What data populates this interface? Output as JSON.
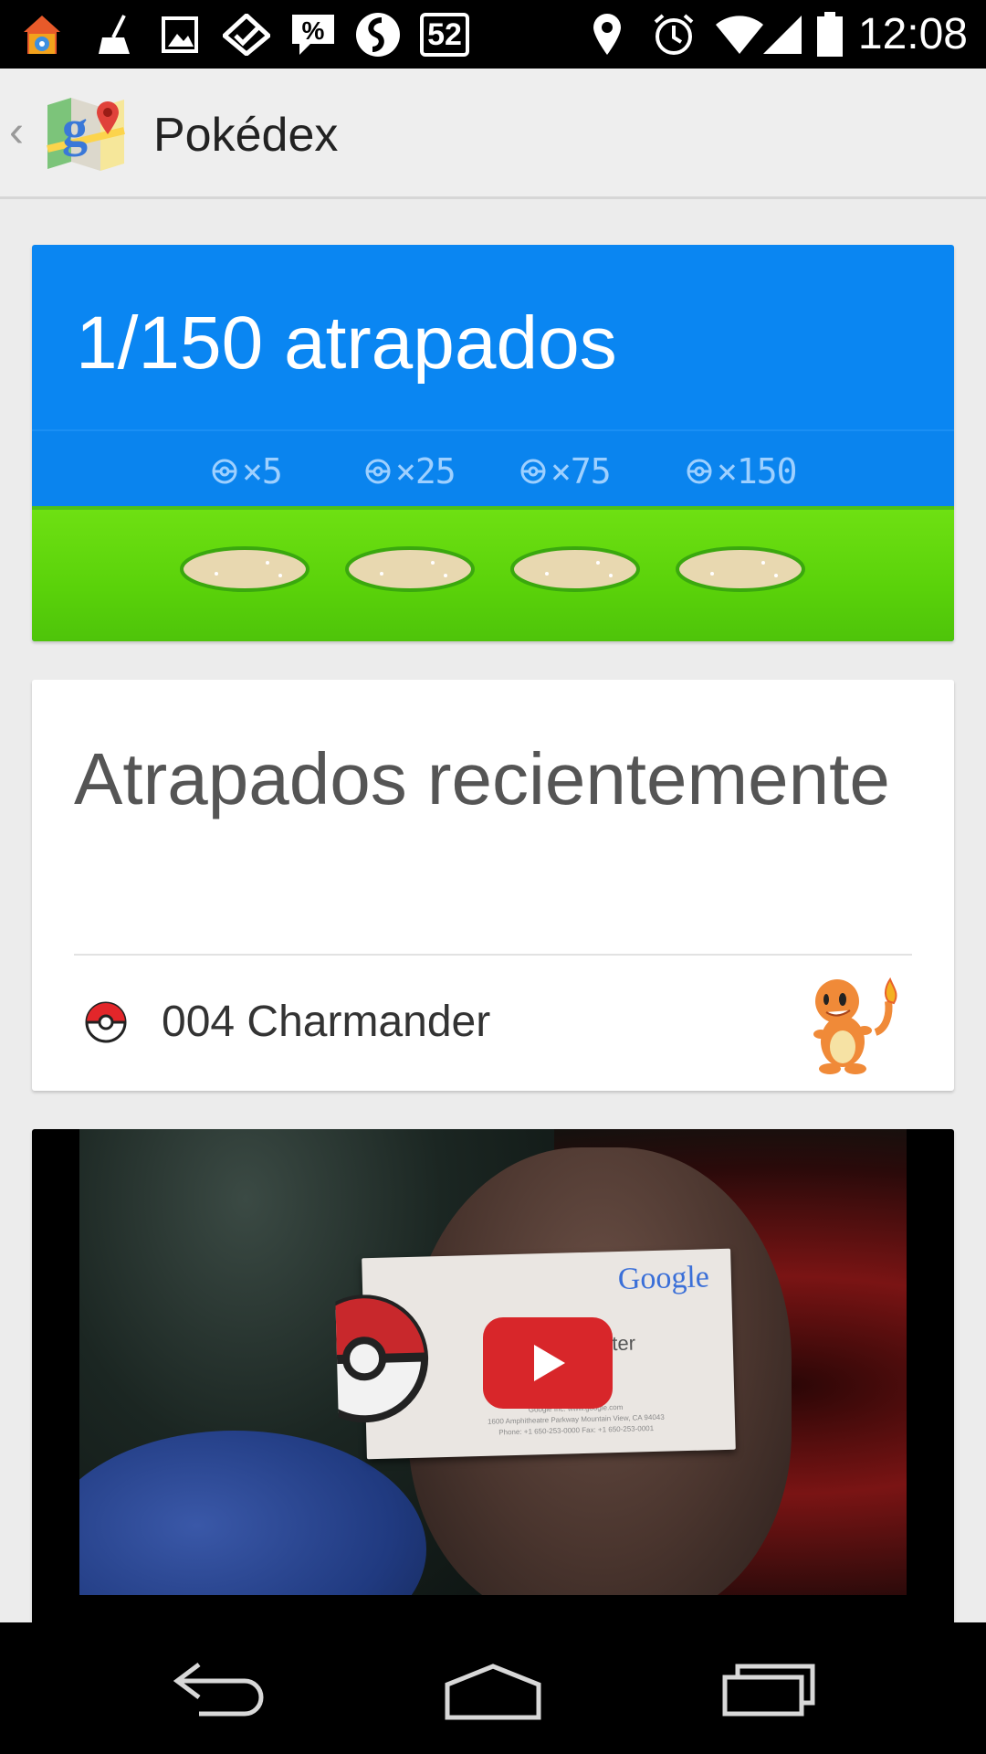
{
  "status_bar": {
    "time": "12:08",
    "notification_badge": "52",
    "icons": [
      "home-color-icon",
      "broom-icon",
      "image-icon",
      "double-check-icon",
      "percent-bubble-icon",
      "shazam-icon",
      "badge-52-icon",
      "location-icon",
      "alarm-icon",
      "wifi-icon",
      "signal-icon",
      "battery-icon"
    ]
  },
  "action_bar": {
    "title": "Pokédex",
    "up_icon": "back-caret-icon",
    "app_icon": "google-maps-icon"
  },
  "progress_card": {
    "title": "1/150 atrapados",
    "caught": 1,
    "total": 150,
    "milestones": [
      "×5",
      "×25",
      "×75",
      "×150"
    ],
    "colors": {
      "sky": "#0a86f2",
      "grass": "#5ad20a",
      "pad": "#e8d8b0"
    }
  },
  "recent_card": {
    "title": "Atrapados recientemente",
    "items": [
      {
        "label": "004 Charmander",
        "icon": "pokeball-icon",
        "sprite": "charmander-sprite"
      }
    ]
  },
  "video_card": {
    "thumbnail": "video-thumbnail",
    "business_card_brand": "Google",
    "business_card_role": "Master",
    "address_line_1": "Google Inc. www.google.com",
    "address_line_2": "1600 Amphitheatre Parkway Mountain View, CA 94043",
    "address_line_3": "Phone: +1 650-253-0000   Fax: +1 650-253-0001",
    "play_icon": "youtube-play-icon"
  },
  "nav_bar": {
    "buttons": [
      "back-nav-icon",
      "home-nav-icon",
      "recents-nav-icon"
    ]
  }
}
